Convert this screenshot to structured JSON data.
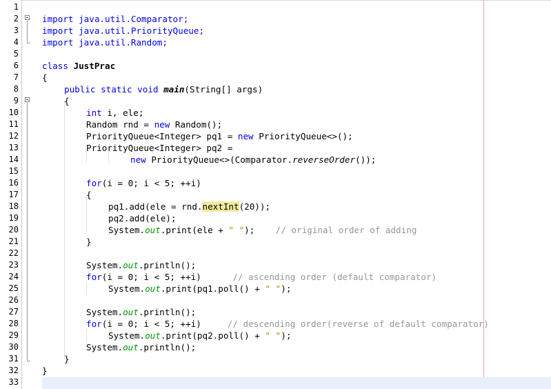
{
  "editor": {
    "line_numbers": [
      "1",
      "2",
      "3",
      "4",
      "5",
      "6",
      "7",
      "8",
      "9",
      "10",
      "11",
      "12",
      "13",
      "14",
      "15",
      "16",
      "17",
      "18",
      "19",
      "20",
      "21",
      "22",
      "23",
      "24",
      "25",
      "26",
      "27",
      "28",
      "29",
      "30",
      "31",
      "32",
      "33"
    ],
    "code": {
      "l2": "import java.util.Comparator;",
      "l3": "import java.util.PriorityQueue;",
      "l4": "import java.util.Random;",
      "l6_kw": "class",
      "l6_name": "JustPrac",
      "l7": "{",
      "l8_kw": "public static void",
      "l8_method": "main",
      "l8_rest": "(String[] args)",
      "l9": "{",
      "l10_kw": "int",
      "l10_rest": " i, ele;",
      "l11_a": "Random rnd = ",
      "l11_kw": "new",
      "l11_b": " Random();",
      "l12_a": "PriorityQueue<Integer> pq1 = ",
      "l12_kw": "new",
      "l12_b": " PriorityQueue<>();",
      "l13": "PriorityQueue<Integer> pq2 =",
      "l14_kw": "new",
      "l14_a": " PriorityQueue<>(Comparator.",
      "l14_italic": "reverseOrder",
      "l14_b": "());",
      "l16_kw": "for",
      "l16_rest": "(i = 0; i < 5; ++i)",
      "l17": "{",
      "l18_a": "pq1.add(ele = rnd.",
      "l18_hl": "nextInt",
      "l18_b": "(20));",
      "l19": "pq2.add(ele);",
      "l20_a": "System.",
      "l20_field": "out",
      "l20_b": ".print(ele + ",
      "l20_str": "\" \"",
      "l20_c": ");",
      "l20_comment": "// original order of adding",
      "l21": "}",
      "l23_a": "System.",
      "l23_field": "out",
      "l23_b": ".println();",
      "l24_kw": "for",
      "l24_rest": "(i = 0; i < 5; ++i)",
      "l24_comment": "// ascending order (default comparator)",
      "l25_a": "System.",
      "l25_field": "out",
      "l25_b": ".print(pq1.poll() + ",
      "l25_str": "\" \"",
      "l25_c": ");",
      "l27_a": "System.",
      "l27_field": "out",
      "l27_b": ".println();",
      "l28_kw": "for",
      "l28_rest": "(i = 0; i < 5; ++i)",
      "l28_comment": "// descending order(reverse of default comparator)",
      "l29_a": "System.",
      "l29_field": "out",
      "l29_b": ".print(pq2.poll() + ",
      "l29_str": "\" \"",
      "l29_c": ");",
      "l30_a": "System.",
      "l30_field": "out",
      "l30_b": ".println();",
      "l31": "}",
      "l32": "}"
    }
  },
  "colors": {
    "keyword": "#0000e6",
    "string": "#ce7b00",
    "comment": "#969696",
    "static_field": "#009900",
    "highlight": "#f2ea9c",
    "margin_line": "#f0a0a0"
  }
}
